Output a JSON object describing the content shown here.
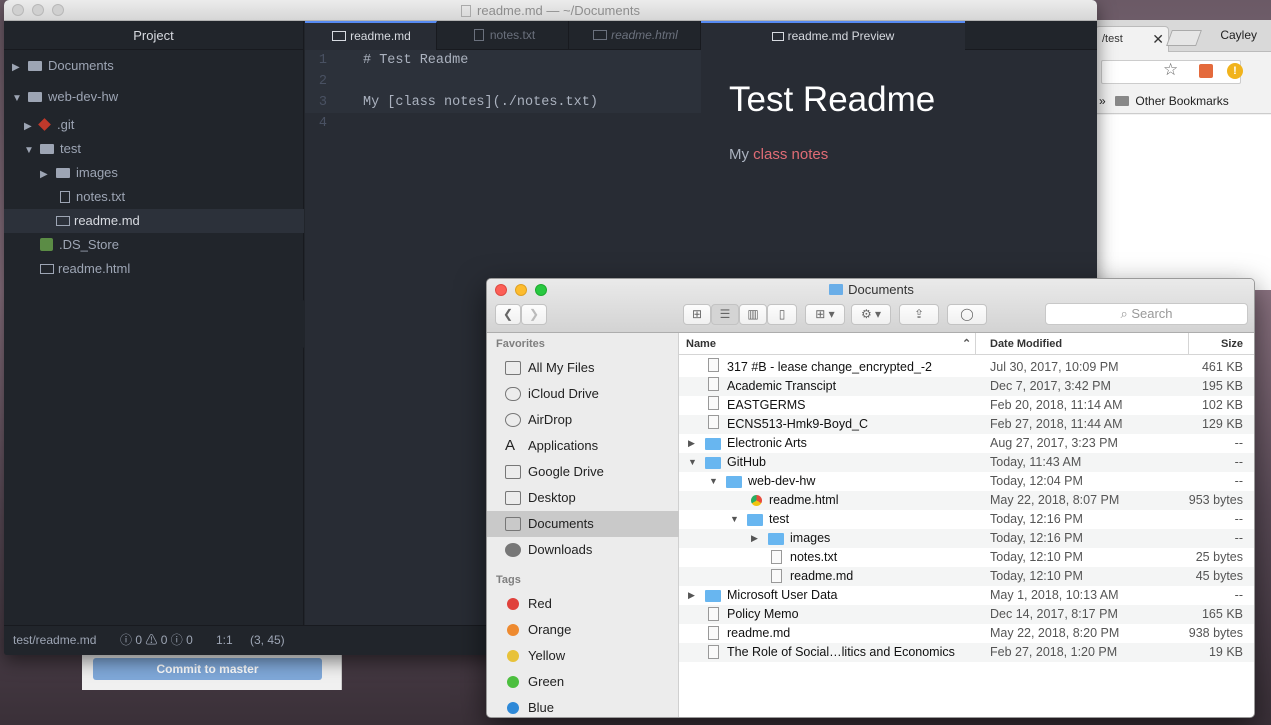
{
  "atom": {
    "title": "readme.md — ~/Documents",
    "tree_header": "Project",
    "tree": [
      {
        "label": "Documents"
      },
      {
        "label": "web-dev-hw"
      },
      {
        "label": ".git"
      },
      {
        "label": "test"
      },
      {
        "label": "images"
      },
      {
        "label": "notes.txt"
      },
      {
        "label": "readme.md"
      },
      {
        "label": ".DS_Store"
      },
      {
        "label": "readme.html"
      }
    ],
    "tabs": [
      "readme.md",
      "notes.txt",
      "readme.html"
    ],
    "editor": {
      "line_numbers": [
        "1",
        "2",
        "3",
        "4"
      ],
      "lines": [
        "# Test Readme",
        "",
        "My [class notes](./notes.txt)",
        ""
      ]
    },
    "preview_tab": "readme.md  Preview",
    "preview": {
      "heading": "Test Readme",
      "text_prefix": "My ",
      "link_text": "class notes"
    },
    "status": {
      "path": "test/readme.md",
      "errors": "0",
      "warnings": "0",
      "infos": "0",
      "cursor": "1:1",
      "selection": "(3, 45)"
    }
  },
  "chrome": {
    "tab_title": "/test",
    "user": "Cayley",
    "bookmarks": "Other Bookmarks"
  },
  "github_desktop": {
    "commit_button": "Commit to master"
  },
  "finder": {
    "title": "Documents",
    "search_placeholder": "Search",
    "favorites_header": "Favorites",
    "favorites": [
      {
        "label": "All My Files",
        "icon": "all-files-icon"
      },
      {
        "label": "iCloud Drive",
        "icon": "cloud-icon"
      },
      {
        "label": "AirDrop",
        "icon": "airdrop-icon"
      },
      {
        "label": "Applications",
        "icon": "applications-icon"
      },
      {
        "label": "Google Drive",
        "icon": "folder-icon"
      },
      {
        "label": "Desktop",
        "icon": "desktop-icon"
      },
      {
        "label": "Documents",
        "icon": "documents-icon"
      },
      {
        "label": "Downloads",
        "icon": "downloads-icon"
      }
    ],
    "tags_header": "Tags",
    "tags": [
      {
        "label": "Red",
        "color": "#e0413b"
      },
      {
        "label": "Orange",
        "color": "#ee8a2f"
      },
      {
        "label": "Yellow",
        "color": "#e8c23a"
      },
      {
        "label": "Green",
        "color": "#4cbf3f"
      },
      {
        "label": "Blue",
        "color": "#2e89d8"
      }
    ],
    "columns": {
      "name": "Name",
      "date": "Date Modified",
      "size": "Size"
    },
    "rows": [
      {
        "name": "317 #B - lease change_encrypted_-2",
        "date": "Jul 30, 2017, 10:09 PM",
        "size": "461 KB"
      },
      {
        "name": "Academic Transcipt",
        "date": "Dec 7, 2017, 3:42 PM",
        "size": "195 KB"
      },
      {
        "name": "EASTGERMS",
        "date": "Feb 20, 2018, 11:14 AM",
        "size": "102 KB"
      },
      {
        "name": "ECNS513-Hmk9-Boyd_C",
        "date": "Feb 27, 2018, 11:44 AM",
        "size": "129 KB"
      },
      {
        "name": "Electronic Arts",
        "date": "Aug 27, 2017, 3:23 PM",
        "size": "--"
      },
      {
        "name": "GitHub",
        "date": "Today, 11:43 AM",
        "size": "--"
      },
      {
        "name": "web-dev-hw",
        "date": "Today, 12:04 PM",
        "size": "--"
      },
      {
        "name": "readme.html",
        "date": "May 22, 2018, 8:07 PM",
        "size": "953 bytes"
      },
      {
        "name": "test",
        "date": "Today, 12:16 PM",
        "size": "--"
      },
      {
        "name": "images",
        "date": "Today, 12:16 PM",
        "size": "--"
      },
      {
        "name": "notes.txt",
        "date": "Today, 12:10 PM",
        "size": "25 bytes"
      },
      {
        "name": "readme.md",
        "date": "Today, 12:10 PM",
        "size": "45 bytes"
      },
      {
        "name": "Microsoft User Data",
        "date": "May 1, 2018, 10:13 AM",
        "size": "--"
      },
      {
        "name": "Policy Memo",
        "date": "Dec 14, 2017, 8:17 PM",
        "size": "165 KB"
      },
      {
        "name": "readme.md",
        "date": "May 22, 2018, 8:20 PM",
        "size": "938 bytes"
      },
      {
        "name": "The Role of Social…litics and Economics",
        "date": "Feb 27, 2018, 1:20 PM",
        "size": "19 KB"
      }
    ]
  }
}
